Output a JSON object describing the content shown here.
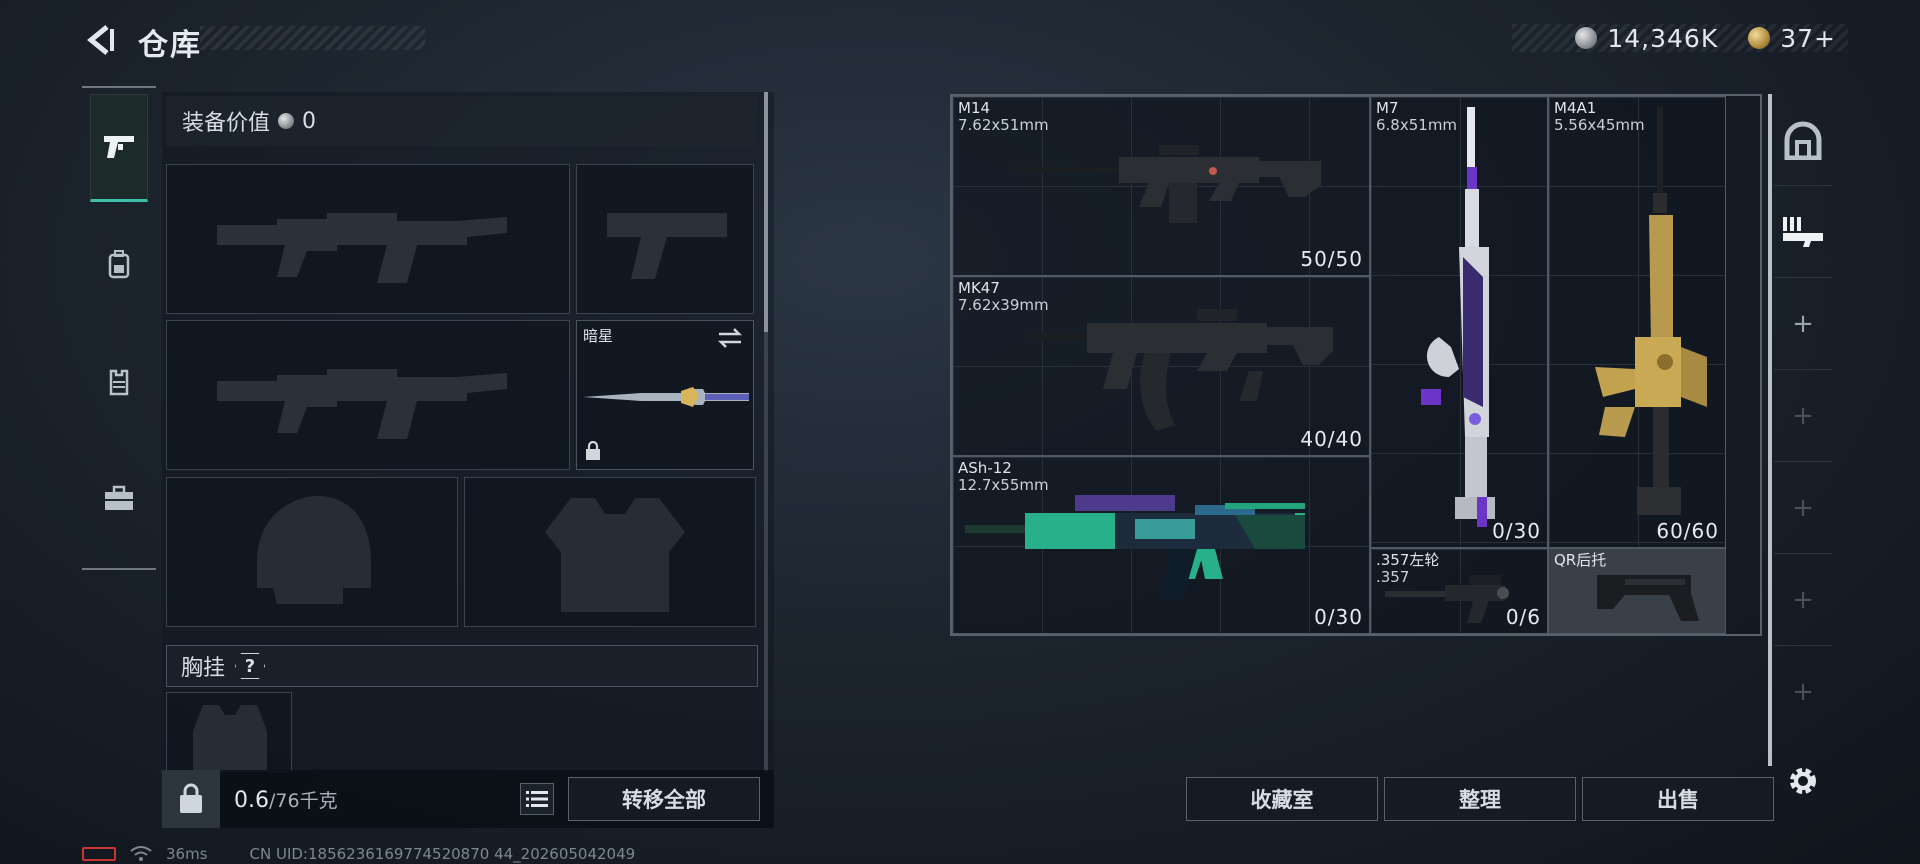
{
  "header": {
    "title": "仓库",
    "currency": [
      {
        "icon": "silver-coin-icon",
        "value": "14,346K"
      },
      {
        "icon": "gold-coin-icon",
        "value": "37+"
      }
    ]
  },
  "left_nav": {
    "tabs": [
      {
        "icon": "pistol-icon",
        "active": true
      },
      {
        "icon": "backpack-icon",
        "active": false
      },
      {
        "icon": "vest-icon",
        "active": false
      },
      {
        "icon": "briefcase-icon",
        "active": false
      }
    ]
  },
  "loadout": {
    "equip_value_label": "装备价值",
    "equip_value": "0",
    "melee_slot": {
      "name": "暗星"
    },
    "chest_rig_label": "胸挂",
    "help_symbol": "?",
    "weight_value": "0.6",
    "weight_capacity": "/76千克",
    "transfer_all": "转移全部"
  },
  "stash": {
    "items": [
      {
        "name": "M14",
        "caliber": "7.62x51mm",
        "ammo": "50/50"
      },
      {
        "name": "MK47",
        "caliber": "7.62x39mm",
        "ammo": "40/40"
      },
      {
        "name": "ASh-12",
        "caliber": "12.7x55mm",
        "ammo": "0/30"
      },
      {
        "name": "M7",
        "caliber": "6.8x51mm",
        "ammo": "0/30"
      },
      {
        "name": "M4A1",
        "caliber": "5.56x45mm",
        "ammo": "60/60"
      },
      {
        "name": ".357左轮",
        "caliber": ".357",
        "ammo": "0/6"
      },
      {
        "name": "QR后托",
        "caliber": "",
        "ammo": ""
      }
    ],
    "buttons": {
      "collection": "收藏室",
      "sort": "整理",
      "sell": "出售"
    }
  },
  "status": {
    "ping": "36ms",
    "uid": "CN UID:1856236169774520870 44_202605042049"
  },
  "colors": {
    "accent": "#3fc0a6",
    "border": "#59626c",
    "battery_low": "#c8362f"
  }
}
